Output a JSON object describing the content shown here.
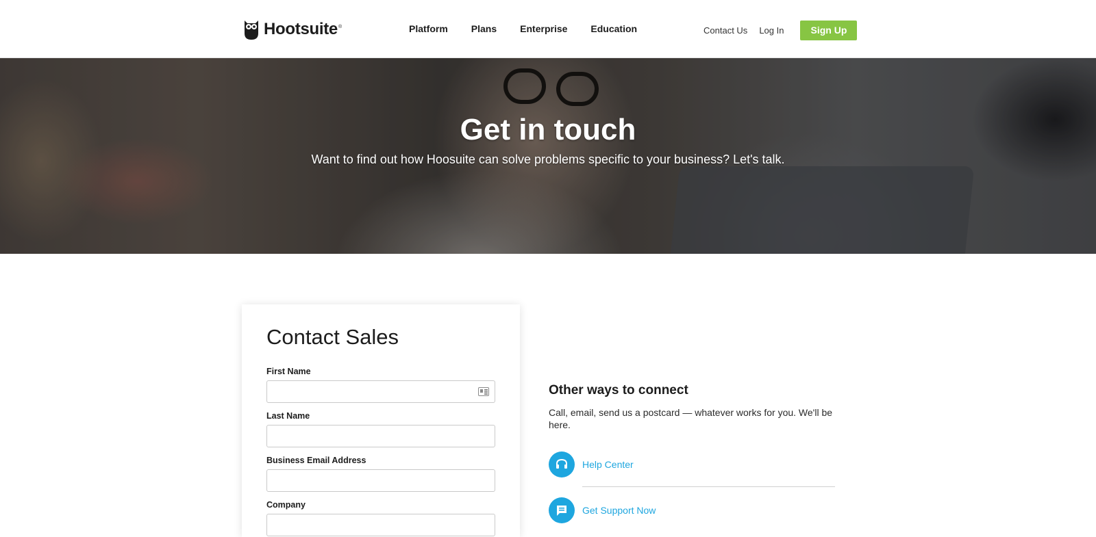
{
  "header": {
    "logo_text": "Hootsuite",
    "logo_reg": "®",
    "nav": [
      "Platform",
      "Plans",
      "Enterprise",
      "Education"
    ],
    "contact_label": "Contact Us",
    "login_label": "Log In",
    "signup_label": "Sign Up",
    "signup_color": "#87c543"
  },
  "hero": {
    "title": "Get in touch",
    "subtitle": "Want to find out how Hoosuite can solve problems specific to your business? Let's talk."
  },
  "form": {
    "title": "Contact Sales",
    "fields": [
      {
        "label": "First Name",
        "value": ""
      },
      {
        "label": "Last Name",
        "value": ""
      },
      {
        "label": "Business Email Address",
        "value": ""
      },
      {
        "label": "Company",
        "value": ""
      }
    ]
  },
  "other": {
    "title": "Other ways to connect",
    "description": "Call, email, send us a postcard — whatever works for you. We'll be here.",
    "links": [
      {
        "label": "Help Center",
        "icon": "headset-icon"
      },
      {
        "label": "Get Support Now",
        "icon": "chat-bubble-icon"
      }
    ],
    "accent_color": "#1ea6df"
  }
}
